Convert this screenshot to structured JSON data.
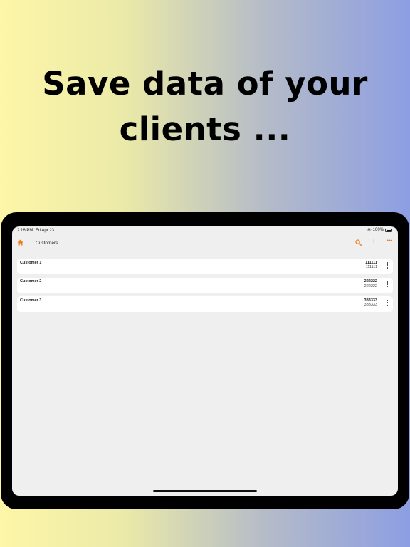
{
  "headline": {
    "line1": "Save data of your",
    "line2": "clients ..."
  },
  "status_bar": {
    "time": "2:16 PM",
    "date": "Fri Apr 23",
    "battery": "100%"
  },
  "nav": {
    "title": "Customers"
  },
  "customers": [
    {
      "name": "Customer 1",
      "code": "111111",
      "subcode": "111111"
    },
    {
      "name": "Customer 2",
      "code": "222222",
      "subcode": "222222"
    },
    {
      "name": "Customer 3",
      "code": "333333",
      "subcode": "333333"
    }
  ],
  "colors": {
    "accent": "#ef7d22",
    "screen_bg": "#efefef",
    "device": "#000000"
  },
  "icons": [
    "home-icon",
    "search-icon",
    "add-icon",
    "more-icon",
    "wifi-icon",
    "battery-icon",
    "kebab-menu-icon"
  ]
}
